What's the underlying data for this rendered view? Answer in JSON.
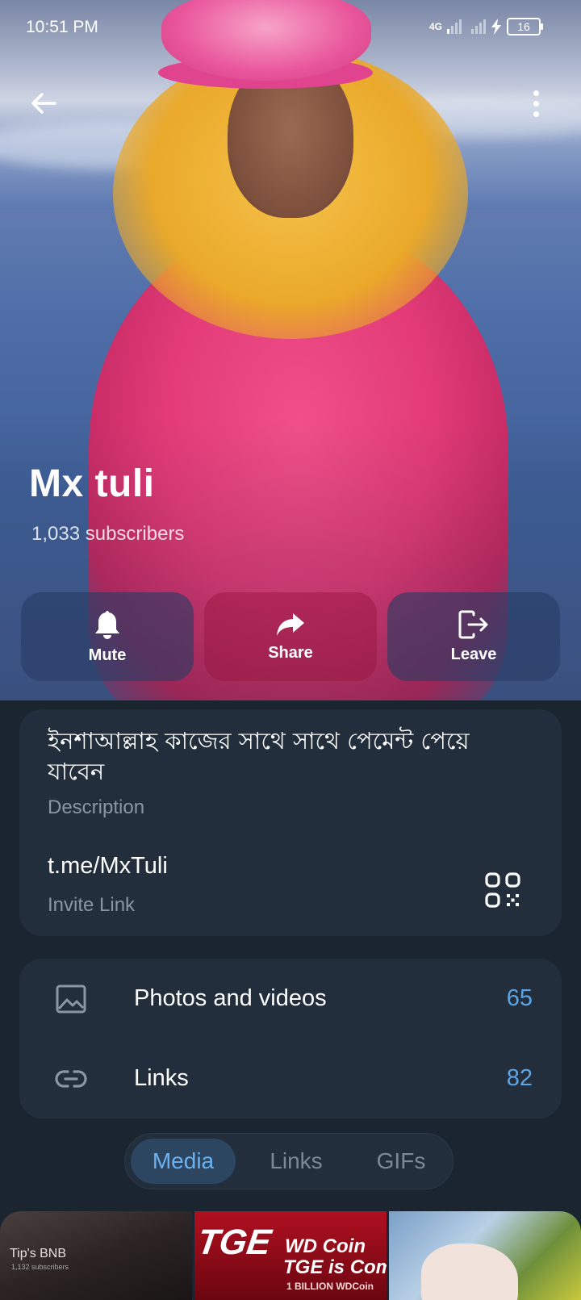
{
  "status_bar": {
    "time": "10:51 PM",
    "network": "4G",
    "battery": "16"
  },
  "header": {
    "back_icon": "arrow-left-icon",
    "more_icon": "more-vertical-icon",
    "title": "Mx tuli",
    "subscribers": "1,033 subscribers"
  },
  "actions": [
    {
      "label": "Mute",
      "icon": "bell-icon"
    },
    {
      "label": "Share",
      "icon": "share-arrow-icon"
    },
    {
      "label": "Leave",
      "icon": "leave-icon"
    }
  ],
  "info": {
    "description": "ইনশাআল্লাহ কাজের সাথে সাথে পেমেন্ট পেয়ে যাবেন",
    "description_label": "Description",
    "link": "t.me/MxTuli",
    "link_label": "Invite Link",
    "qr_icon": "qr-code-icon"
  },
  "shared_media": [
    {
      "label": "Photos and videos",
      "count": "65",
      "icon": "image-icon"
    },
    {
      "label": "Links",
      "count": "82",
      "icon": "link-icon"
    }
  ],
  "tabs": [
    {
      "label": "Media",
      "active": true
    },
    {
      "label": "Links",
      "active": false
    },
    {
      "label": "GIFs",
      "active": false
    }
  ],
  "thumbnails": [
    {
      "title": "Tip's BNB",
      "subtitle": "1,132 subscribers"
    },
    {
      "title": "TGE",
      "line1": "WD Coin",
      "line2": "TGE is Comi",
      "line3": "1 BILLION WDCoin"
    },
    {}
  ],
  "colors": {
    "background": "#1b2530",
    "card": "#222e3b",
    "accent": "#5aa5e6",
    "muted_text": "#8a96a3"
  }
}
